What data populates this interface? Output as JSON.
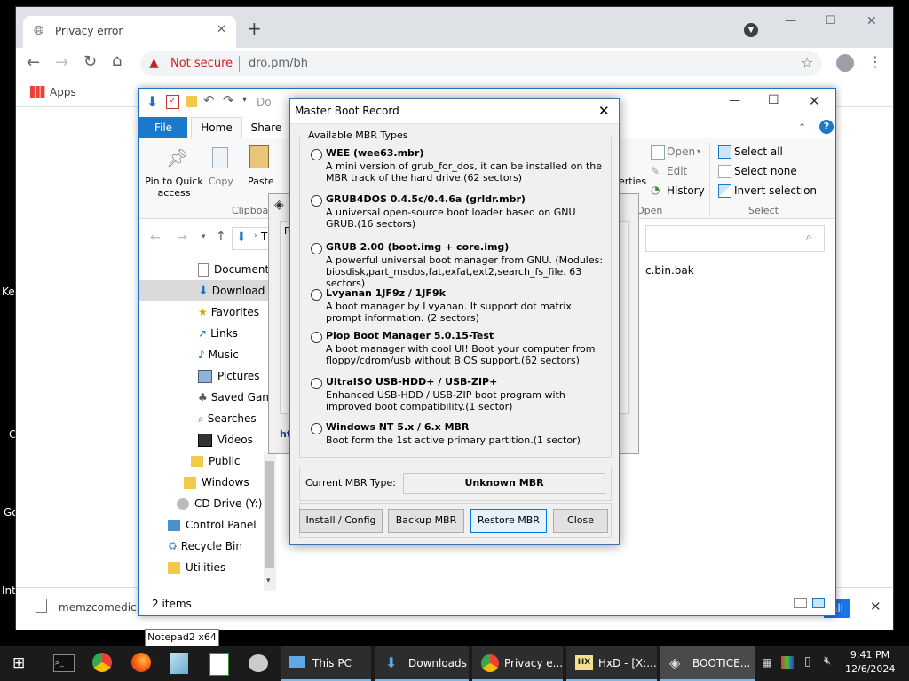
{
  "desktop": {
    "edge_labels": [
      "Key",
      "C",
      "Go",
      "Int"
    ]
  },
  "chrome": {
    "tab_title": "Privacy error",
    "new_tab": "+",
    "security_label": "Not secure",
    "url": "dro.pm/bh",
    "bookmarks_apps": "Apps",
    "download_file": "memzcomedic.i",
    "show_all": "all",
    "window_controls": {
      "minimize": "—",
      "maximize": "☐",
      "close": "✕"
    }
  },
  "explorer": {
    "qat_path": "Do",
    "window_controls": {
      "minimize": "—",
      "maximize": "☐",
      "close": "✕"
    },
    "tabs": [
      "File",
      "Home",
      "Share"
    ],
    "ribbon": {
      "clipboard": {
        "pin": "Pin to Quick access",
        "copy": "Copy",
        "paste": "Paste",
        "group": "Clipboard"
      },
      "properties_partial": "erties",
      "open": {
        "open": "Open",
        "edit": "Edit",
        "history": "History",
        "group": "Open"
      },
      "select": {
        "select_all": "Select all",
        "select_none": "Select none",
        "invert": "Invert selection",
        "group": "Select"
      }
    },
    "address_partial": "T",
    "nav_items": [
      {
        "label": "Document",
        "indent": 1
      },
      {
        "label": "Download",
        "indent": 1,
        "selected": true
      },
      {
        "label": "Favorites",
        "indent": 1
      },
      {
        "label": "Links",
        "indent": 1
      },
      {
        "label": "Music",
        "indent": 1
      },
      {
        "label": "Pictures",
        "indent": 1
      },
      {
        "label": "Saved Gan",
        "indent": 1
      },
      {
        "label": "Searches",
        "indent": 1
      },
      {
        "label": "Videos",
        "indent": 1
      },
      {
        "label": "Public",
        "indent": 2
      },
      {
        "label": "Windows",
        "indent": 3
      },
      {
        "label": "CD Drive (Y:) H",
        "indent": 4
      },
      {
        "label": "Control Panel",
        "indent": 5
      },
      {
        "label": "Recycle Bin",
        "indent": 5
      },
      {
        "label": "Utilities",
        "indent": 5
      }
    ],
    "file_partial": "c.bin.bak",
    "status_items": "2 items"
  },
  "bootice_back": {
    "tab_partial": "P",
    "link_partial": "htt"
  },
  "mbr_dialog": {
    "title": "Master Boot Record",
    "group_label": "Available MBR Types",
    "options": [
      {
        "name": "WEE (wee63.mbr)",
        "desc": "A mini version of grub_for_dos, it can be installed on the MBR track of the hard drive.(62 sectors)"
      },
      {
        "name": "GRUB4DOS 0.4.5c/0.4.6a (grldr.mbr)",
        "desc": "A universal open-source boot loader based on GNU GRUB.(16 sectors)"
      },
      {
        "name": "GRUB 2.00 (boot.img + core.img)",
        "desc": "A powerful universal boot manager from GNU. (Modules: biosdisk,part_msdos,fat,exfat,ext2,search_fs_file. 63 sectors)"
      },
      {
        "name": "Lvyanan 1JF9z / 1JF9k",
        "desc": "A boot manager by Lvyanan. It support dot matrix prompt information. (2 sectors)"
      },
      {
        "name": "Plop Boot Manager 5.0.15-Test",
        "desc": "A boot manager with cool UI! Boot your computer from floppy/cdrom/usb without BIOS support.(62 sectors)"
      },
      {
        "name": "UltraISO USB-HDD+ / USB-ZIP+",
        "desc": "Enhanced USB-HDD / USB-ZIP boot program with improved boot compatibility.(1 sector)"
      },
      {
        "name": "Windows NT 5.x / 6.x MBR",
        "desc": "Boot form the 1st active primary partition.(1 sector)"
      }
    ],
    "current_label": "Current MBR Type:",
    "current_value": "Unknown MBR",
    "buttons": {
      "install": "Install / Config",
      "backup": "Backup MBR",
      "restore": "Restore MBR",
      "close": "Close"
    }
  },
  "tooltip": "Notepad2 x64",
  "taskbar": {
    "buttons": [
      {
        "label": "This PC",
        "icon": "pc-icon"
      },
      {
        "label": "Downloads",
        "icon": "download-folder-icon"
      },
      {
        "label": "Privacy e...",
        "icon": "chrome-icon"
      },
      {
        "label": "HxD - [X:...",
        "icon": "hxd-icon"
      },
      {
        "label": "BOOTICE...",
        "icon": "bootice-icon"
      }
    ],
    "time": "9:41 PM",
    "date": "12/6/2024"
  },
  "colors": {
    "accent": "#0078d7",
    "chrome_warning": "#c5221f",
    "taskbar": "#1b1b1b"
  }
}
